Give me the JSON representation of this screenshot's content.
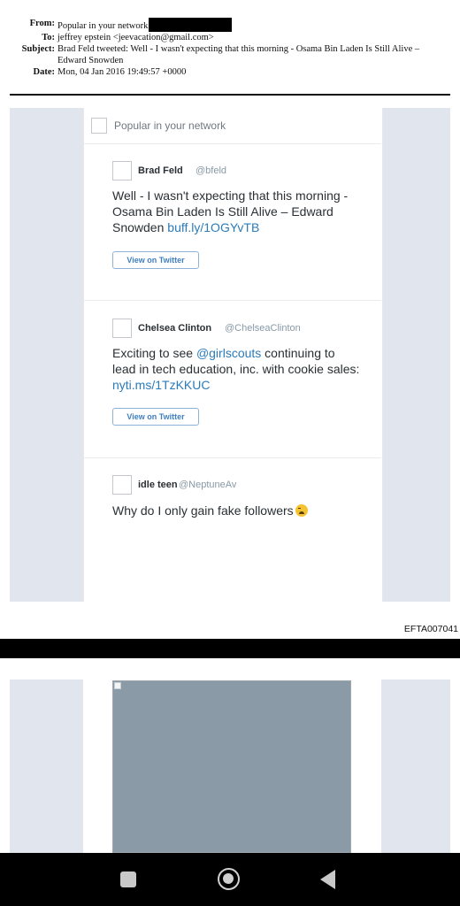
{
  "email": {
    "from_label": "From:",
    "from_value": "Popular in your network",
    "to_label": "To:",
    "to_value": "jeffrey epstein <jeevacation@gmail.com>",
    "subject_label": "Subject:",
    "subject_value": "Brad Feld tweeted: Well - I wasn't expecting that this morning - Osama Bin Laden Is Still Alive – Edward Snowden",
    "date_label": "Date:",
    "date_value": "Mon, 04 Jan 2016 19:49:57 +0000"
  },
  "card": {
    "network_title": "Popular in your network",
    "tweets": [
      {
        "name": "Brad Feld",
        "handle": "@bfeld",
        "text_line1": "Well - I wasn't expecting that this morning -",
        "text_line2": "Osama Bin Laden Is Still Alive – Edward",
        "text_line3_plain": "Snowden ",
        "link": "buff.ly/1OGYvTB",
        "button": "View on Twitter"
      },
      {
        "name": "Chelsea Clinton",
        "handle": "@ChelseaClinton",
        "text_prefix": "Exciting to see ",
        "mention": "@girlscouts",
        "text_suffix": " continuing to",
        "text_line2": "lead in tech education, inc. with cookie sales:",
        "link": "nyti.ms/1TzKKUC",
        "button": "View on Twitter"
      },
      {
        "name": "idle teen",
        "handle": "@NeptuneAv",
        "text": "Why do I only gain fake followers"
      }
    ]
  },
  "footer": {
    "doc_id": "EFTA007041"
  },
  "colors": {
    "link": "#2b7bb9",
    "panel": "#e1e5ee",
    "image_placeholder": "#8a9ba7"
  },
  "icons": [
    "broken-image-icon",
    "weary-face-emoji",
    "nav-recents-icon",
    "nav-home-icon",
    "nav-back-icon"
  ]
}
